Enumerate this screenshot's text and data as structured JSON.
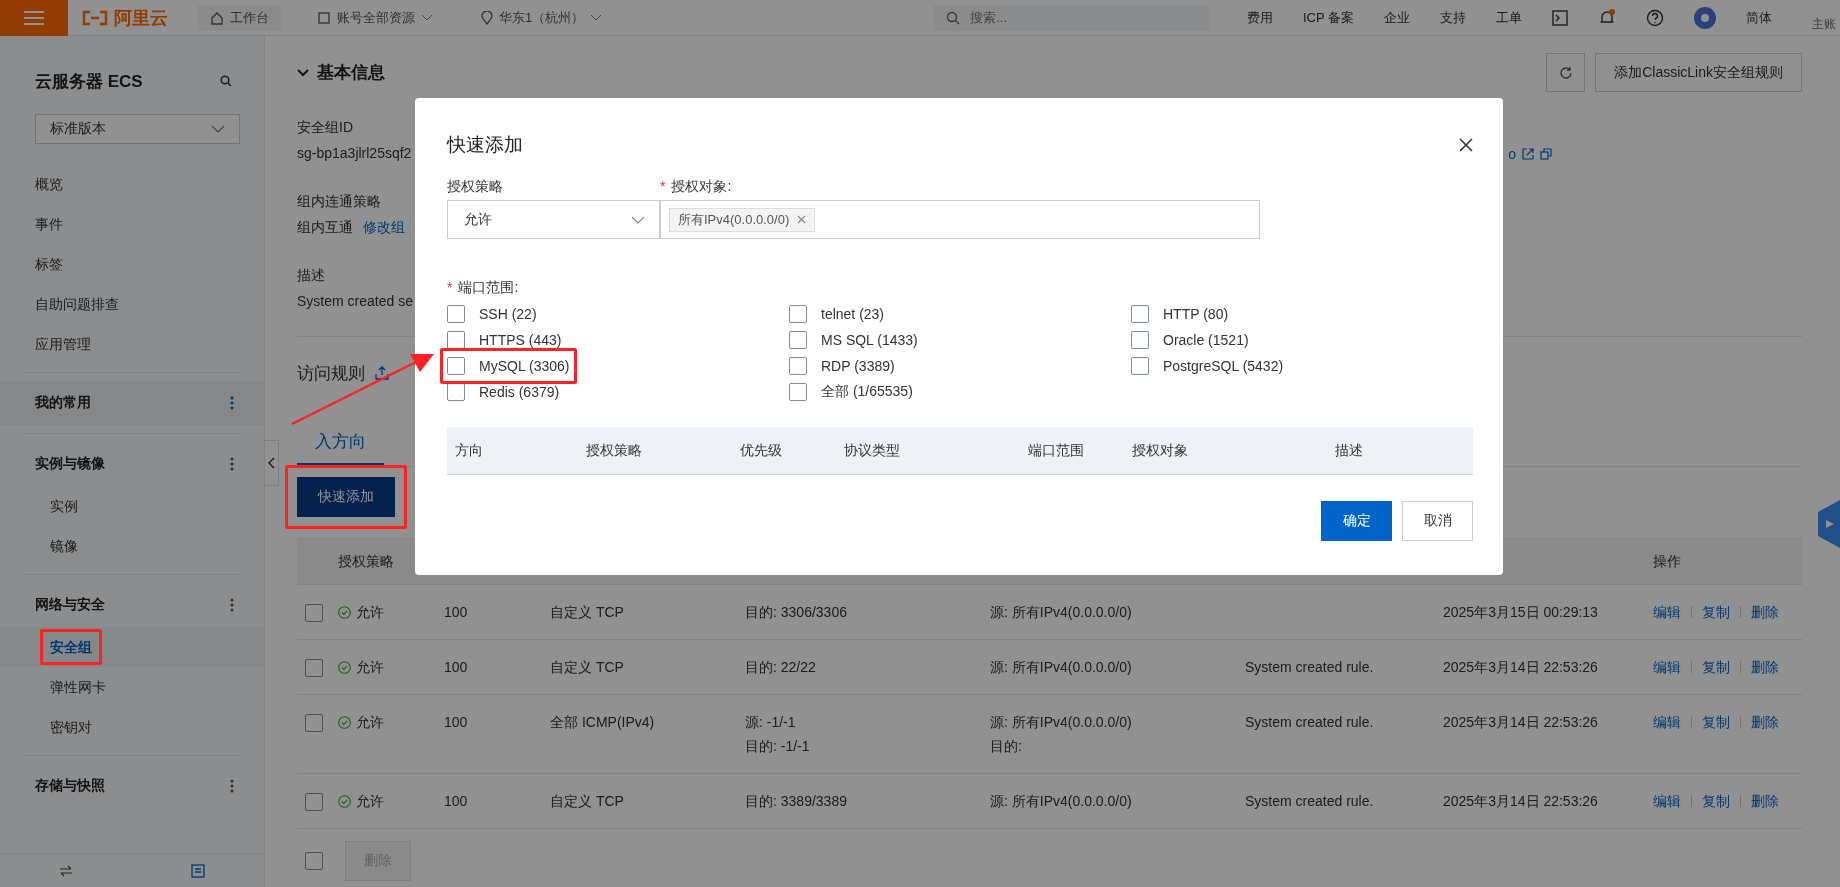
{
  "top_bar": {
    "logo_text": "阿里云",
    "workbench": "工作台",
    "resource_scope": "账号全部资源",
    "region": "华东1（杭州）",
    "search_placeholder": "搜索...",
    "links": [
      "费用",
      "ICP 备案",
      "企业",
      "支持",
      "工单"
    ],
    "language": "简体",
    "account": "主账"
  },
  "sidebar": {
    "title": "云服务器 ECS",
    "version_select": "标准版本",
    "groups": [
      {
        "items": [
          {
            "label": "概览",
            "selected": false
          },
          {
            "label": "事件",
            "selected": false
          },
          {
            "label": "标签",
            "selected": false
          },
          {
            "label": "自助问题排查",
            "selected": false
          },
          {
            "label": "应用管理",
            "selected": false
          }
        ]
      },
      {
        "title": "我的常用",
        "shaded": true
      },
      {
        "title": "实例与镜像",
        "items": [
          {
            "label": "实例",
            "selected": false
          },
          {
            "label": "镜像",
            "selected": false
          }
        ]
      },
      {
        "title": "网络与安全",
        "items": [
          {
            "label": "安全组",
            "selected": true,
            "highlighted": true
          },
          {
            "label": "弹性网卡",
            "selected": false
          },
          {
            "label": "密钥对",
            "selected": false
          }
        ]
      },
      {
        "title": "存储与快照"
      }
    ]
  },
  "basic_info": {
    "title": "基本信息",
    "expanded": true,
    "toolbar_button": "添加ClassicLink安全组规则",
    "fields": [
      {
        "label": "安全组ID",
        "value": "sg-bp1a3jlrl25sqf2"
      },
      {
        "label": "组内连通策略",
        "value": "组内互通",
        "link": "修改组"
      },
      {
        "label": "描述",
        "value": "System created se"
      }
    ],
    "side_fragment": "o"
  },
  "rules": {
    "title": "访问规则",
    "tabs": [
      {
        "label": "入方向",
        "selected": true
      }
    ],
    "quick_add_button": {
      "label": "快速添加",
      "highlighted": true
    },
    "table": {
      "columns": [
        "授权策略",
        "操作"
      ],
      "rows": [
        {
          "checked": false,
          "policy": "允许",
          "priority": "100",
          "protocol": "自定义 TCP",
          "port_range": [
            "目的: 3306/3306"
          ],
          "target": [
            "源: 所有IPv4(0.0.0.0/0)"
          ],
          "time": "2025年3月15日 00:29:13",
          "actions": [
            "编辑",
            "复制",
            "删除"
          ]
        },
        {
          "checked": false,
          "policy": "允许",
          "priority": "100",
          "protocol": "自定义 TCP",
          "port_range": [
            "目的: 22/22"
          ],
          "target": [
            "源: 所有IPv4(0.0.0.0/0)"
          ],
          "description": "System created rule.",
          "time": "2025年3月14日 22:53:26",
          "actions": [
            "编辑",
            "复制",
            "删除"
          ]
        },
        {
          "checked": false,
          "policy": "允许",
          "priority": "100",
          "protocol": "全部 ICMP(IPv4)",
          "port_range": [
            "源: -1/-1",
            "目的: -1/-1"
          ],
          "target": [
            "源: 所有IPv4(0.0.0.0/0)",
            "目的:"
          ],
          "description": "System created rule.",
          "time": "2025年3月14日 22:53:26",
          "actions": [
            "编辑",
            "复制",
            "删除"
          ]
        },
        {
          "checked": false,
          "policy": "允许",
          "priority": "100",
          "protocol": "自定义 TCP",
          "port_range": [
            "目的: 3389/3389"
          ],
          "target": [
            "源: 所有IPv4(0.0.0.0/0)"
          ],
          "description": "System created rule.",
          "time": "2025年3月14日 22:53:26",
          "actions": [
            "编辑",
            "复制",
            "删除"
          ]
        }
      ]
    },
    "bulk_delete": {
      "select_all_checked": false,
      "label": "删除",
      "disabled": true
    }
  },
  "modal": {
    "title": "快速添加",
    "policy": {
      "label": "授权策略",
      "value": "允许"
    },
    "target": {
      "label": "授权对象:",
      "required_mark": "*",
      "tags": [
        "所有IPv4(0.0.0.0/0)"
      ]
    },
    "ports": {
      "label": "端口范围:",
      "required_mark": "*",
      "options": [
        {
          "label": "SSH (22)",
          "checked": false
        },
        {
          "label": "telnet (23)",
          "checked": false
        },
        {
          "label": "HTTP (80)",
          "checked": false
        },
        {
          "label": "HTTPS (443)",
          "checked": false
        },
        {
          "label": "MS SQL (1433)",
          "checked": false
        },
        {
          "label": "Oracle (1521)",
          "checked": false
        },
        {
          "label": "MySQL (3306)",
          "checked": false,
          "highlighted": true
        },
        {
          "label": "RDP (3389)",
          "checked": false
        },
        {
          "label": "PostgreSQL (5432)",
          "checked": false
        },
        {
          "label": "Redis (6379)",
          "checked": false
        },
        {
          "label": "全部 (1/65535)",
          "checked": false
        }
      ]
    },
    "preview_columns": [
      "方向",
      "授权策略",
      "优先级",
      "协议类型",
      "端口范围",
      "授权对象",
      "描述"
    ],
    "buttons": [
      {
        "label": "确定",
        "kind": "primary"
      },
      {
        "label": "取消",
        "kind": "default"
      }
    ]
  }
}
